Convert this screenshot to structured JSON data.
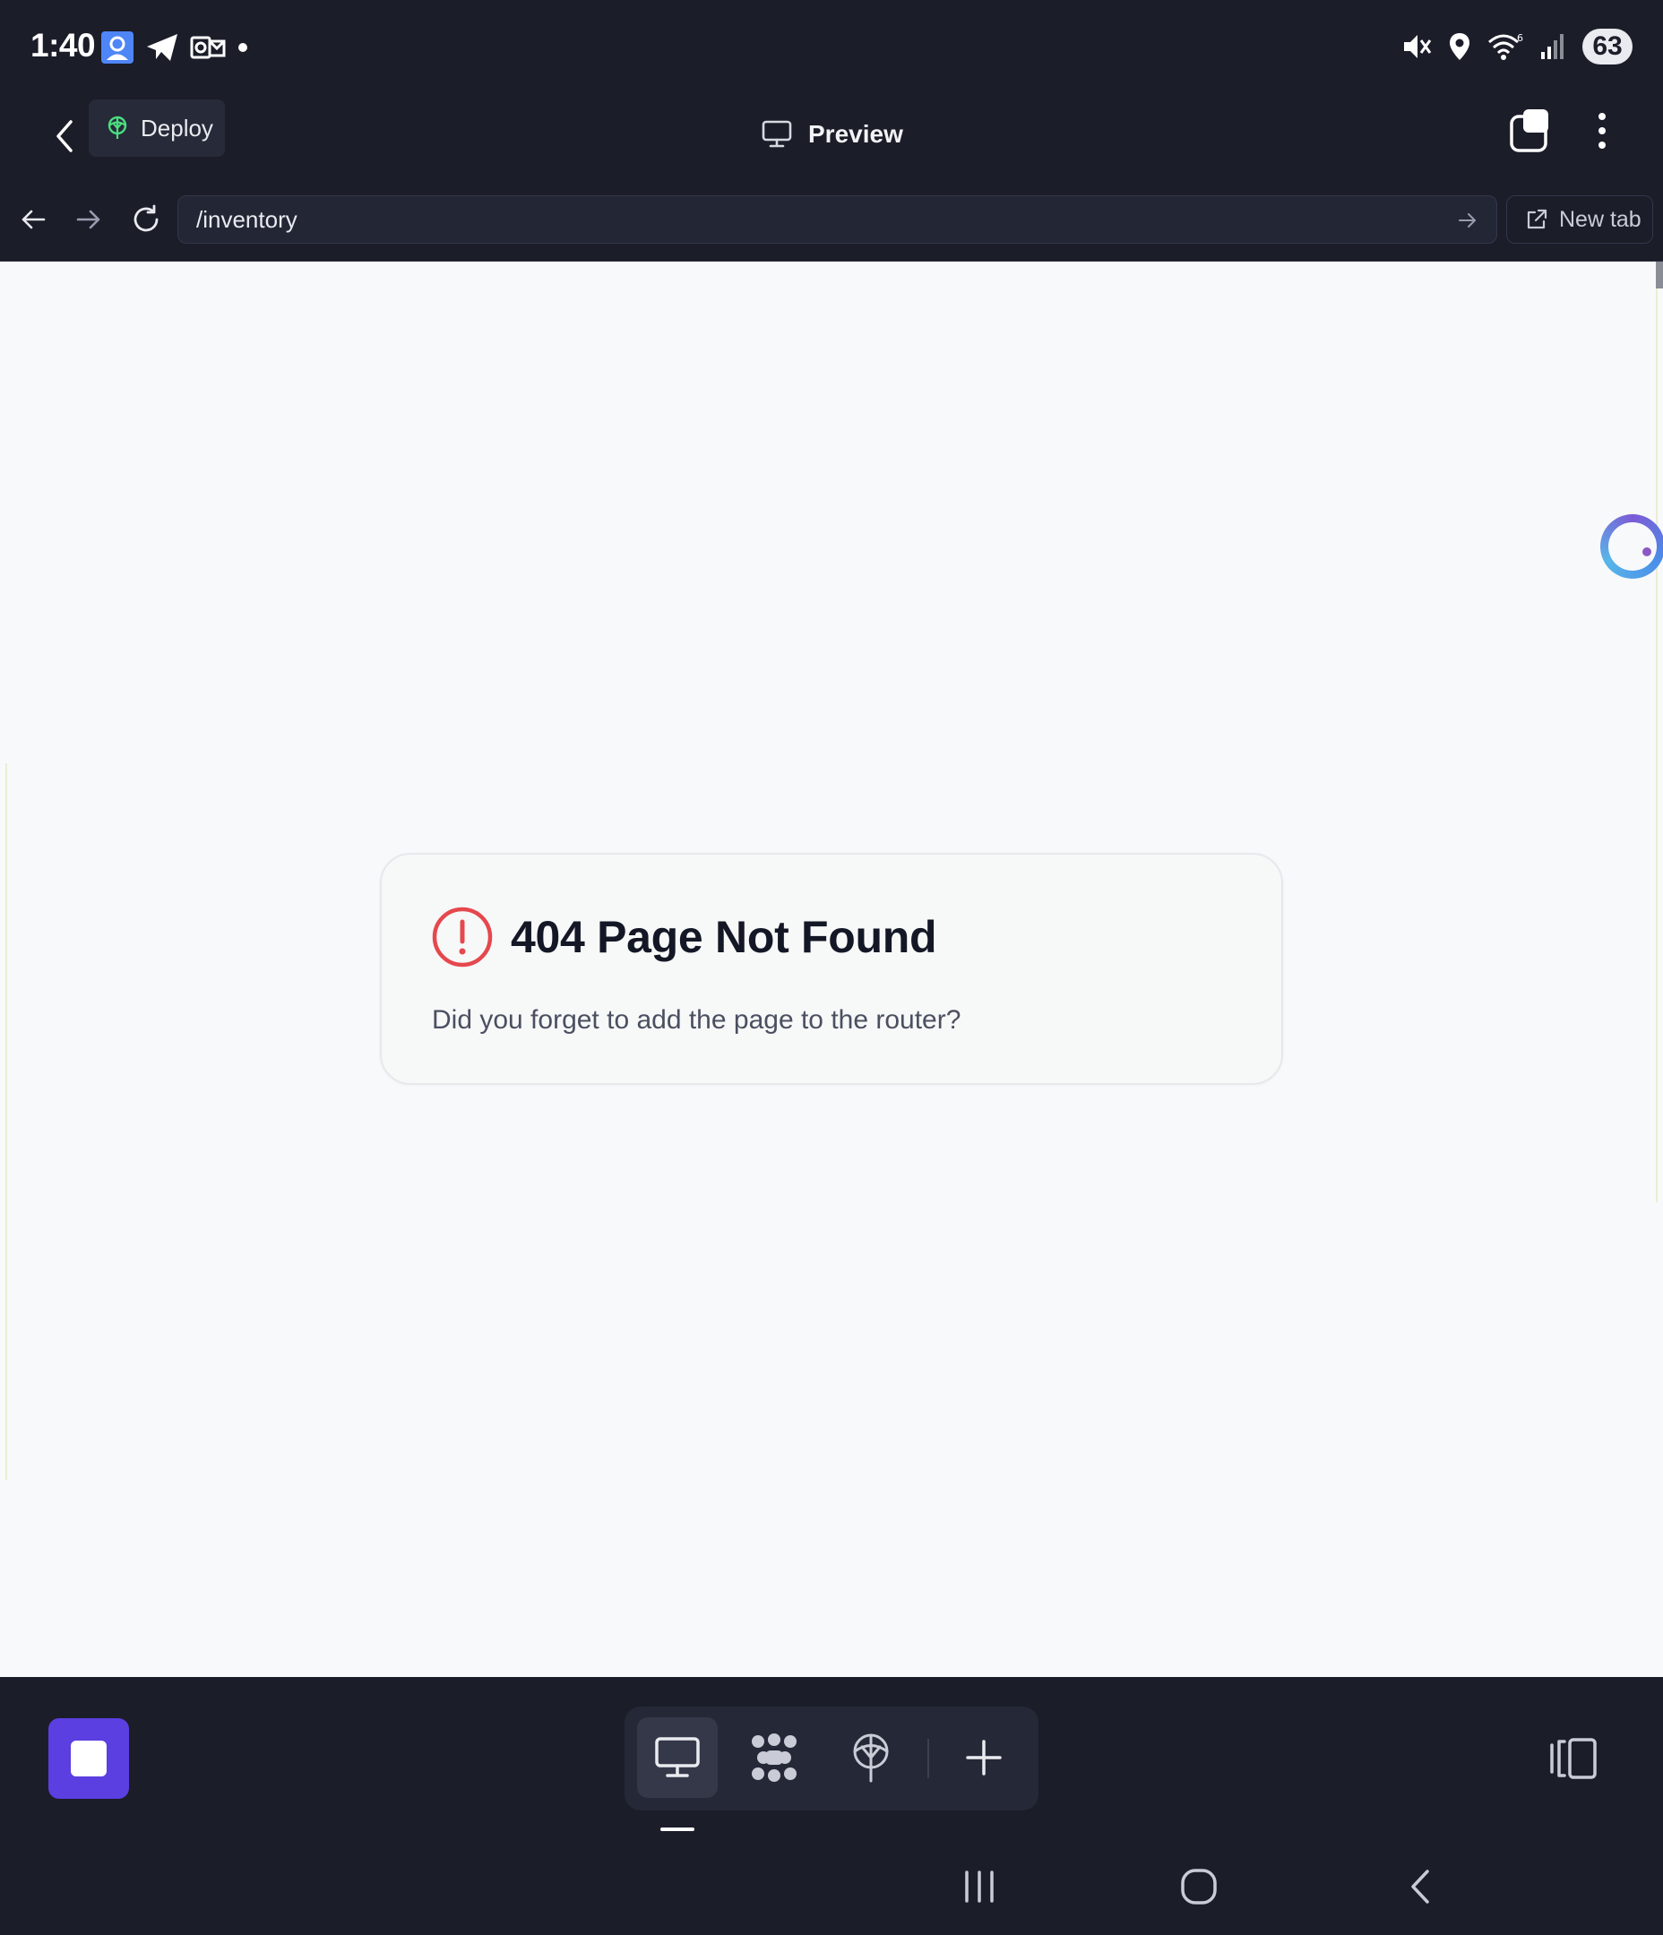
{
  "status_bar": {
    "time": "1:40",
    "battery": "63",
    "left_icons": [
      "contacts-app-icon",
      "telegram-icon",
      "outlook-icon",
      "notification-dot"
    ],
    "right_icons": [
      "mute-icon",
      "location-icon",
      "wifi-6-icon",
      "signal-icon"
    ]
  },
  "app_bar": {
    "deploy_label": "Deploy",
    "title": "Preview"
  },
  "browser_bar": {
    "url": "/inventory",
    "new_tab_label": "New tab"
  },
  "page": {
    "error_title": "404 Page Not Found",
    "error_message": "Did you forget to add the page to the router?",
    "error_icon": "alert-circle-icon",
    "error_color": "#e5484d"
  },
  "bottom_toolbar": {
    "tools": [
      "preview-icon",
      "workflows-icon",
      "deploy-icon",
      "add-icon"
    ],
    "active_tool": "preview-icon",
    "accent": "#5b3fe0"
  }
}
